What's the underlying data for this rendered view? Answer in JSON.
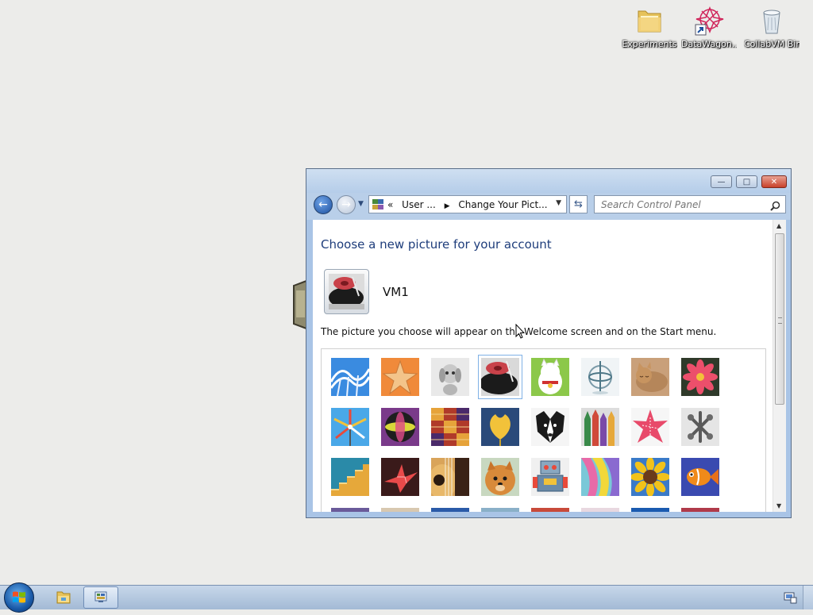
{
  "desktop": {
    "icons": [
      {
        "label": "Experiments",
        "icon": "folder-icon"
      },
      {
        "label": "DataWagon...",
        "icon": "datawagon-shortcut-icon"
      },
      {
        "label": "CollabVM Bin",
        "icon": "recycle-bin-icon"
      }
    ]
  },
  "window": {
    "caption_buttons": {
      "minimize": "—",
      "maximize": "□",
      "close": "✕"
    },
    "nav": {
      "back": "←",
      "forward": "→"
    },
    "breadcrumb": {
      "prefix": "«",
      "items": [
        "User ...",
        "Change Your Pict..."
      ]
    },
    "search": {
      "placeholder": "Search Control Panel"
    },
    "content": {
      "heading": "Choose a new picture for your account",
      "username": "VM1",
      "note": "The picture you choose will appear on the Welcome screen and on the Start menu.",
      "pictures": [
        [
          "roller-coaster",
          "starfish",
          "robot-dog",
          "turntable",
          "lucky-cat",
          "gyroscope",
          "sleeping-kitten",
          "pink-flower"
        ],
        [
          "pinwheel",
          "striped-ball",
          "textile-squares",
          "yellow-leaf",
          "border-collie",
          "crayons",
          "star-lantern",
          "jacks"
        ],
        [
          "stairs",
          "origami-crane",
          "guitar",
          "pomeranian",
          "toy-robot",
          "silk-scarves",
          "sunflower",
          "fish"
        ]
      ],
      "selected": "turntable"
    }
  },
  "taskbar": {
    "items": [
      "start-button",
      "windows-explorer",
      "control-panel"
    ]
  },
  "colors": {
    "heading": "#1e3d7b",
    "selection": "#7fb1e6"
  }
}
